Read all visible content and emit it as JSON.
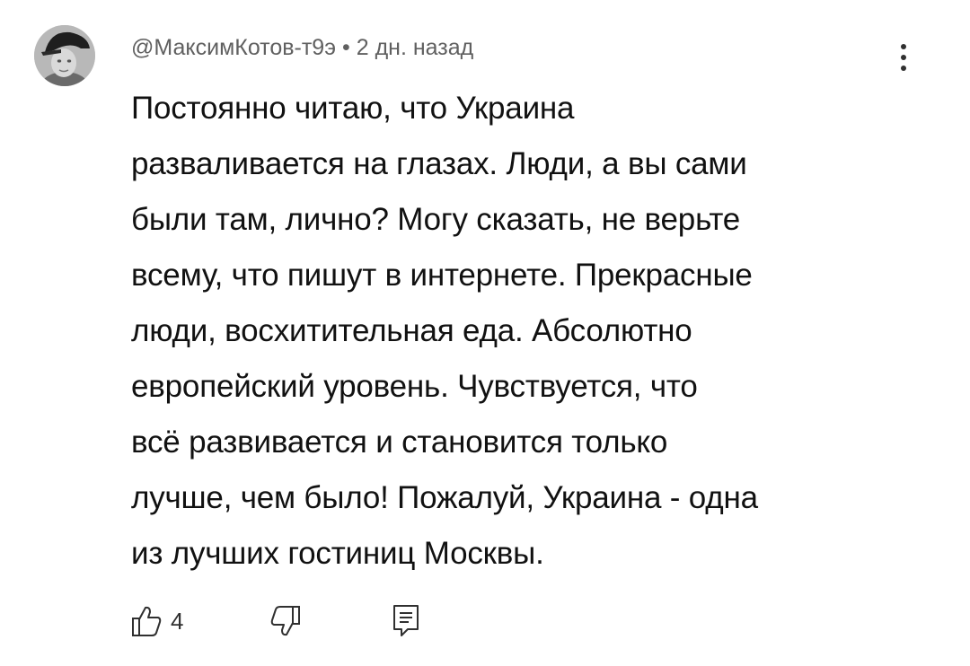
{
  "comment": {
    "author": "@МаксимКотов-т9э",
    "separator": "•",
    "time": "2 дн. назад",
    "text_lines": [
      "Постоянно читаю, что Украина",
      "разваливается на глазах. Люди, а вы сами",
      "были там, лично? Могу сказать, не верьте",
      "всему, что пишут в интернете. Прекрасные",
      "люди, восхитительная еда. Абсолютно",
      "европейский уровень. Чувствуется, что",
      "всё развивается и становится только",
      "лучше, чем было! Пожалуй, Украина - одна",
      "из лучших гостиниц Москвы."
    ],
    "likes": "4"
  },
  "icons": {
    "like": "thumbs-up-icon",
    "dislike": "thumbs-down-icon",
    "reply": "reply-comment-icon",
    "more": "vertical-dots-icon"
  },
  "colors": {
    "text": "#111111",
    "meta": "#606060",
    "icon": "#303030",
    "background": "#ffffff"
  }
}
